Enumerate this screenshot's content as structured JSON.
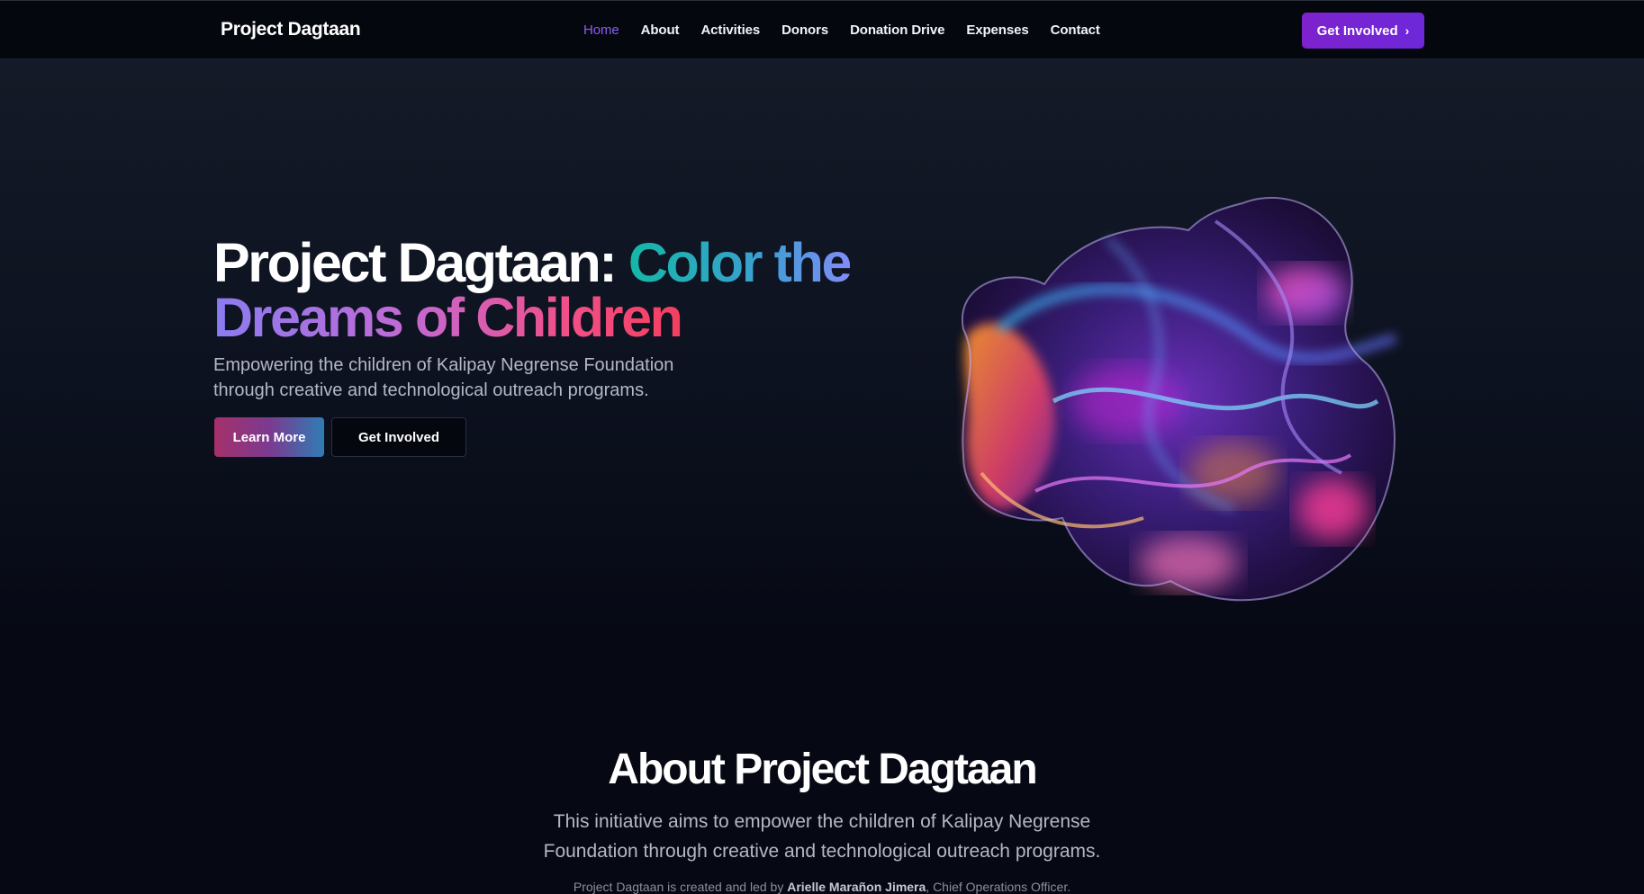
{
  "nav": {
    "brand": "Project Dagtaan",
    "links": [
      "Home",
      "About",
      "Activities",
      "Donors",
      "Donation Drive",
      "Expenses",
      "Contact"
    ],
    "active": "Home",
    "cta_label": "Get Involved",
    "cta_icon": "chevron-right-icon"
  },
  "hero": {
    "title_plain": "Project Dagtaan: ",
    "title_grad1": "Color the",
    "title_grad2": "Dreams of Children",
    "subtitle_line1": "Empowering the children of Kalipay Negrense Foundation",
    "subtitle_line2": "through creative and technological outreach programs.",
    "learn_more_label": "Learn More",
    "get_involved_label": "Get Involved",
    "art": "abstract-iridescent-fluid-shape"
  },
  "about": {
    "title": "About Project Dagtaan",
    "text_line1": "This initiative aims to empower the children of Kalipay Negrense",
    "text_line2": "Foundation through creative and technological outreach programs.",
    "credit_prefix": "Project Dagtaan is created and led by ",
    "credit_name": "Arielle Marañon Jimera",
    "credit_suffix": ", Chief Operations Officer."
  },
  "colors": {
    "background": "#060914",
    "accent": "#7c3aed",
    "nav_active": "#8b5cf6"
  }
}
